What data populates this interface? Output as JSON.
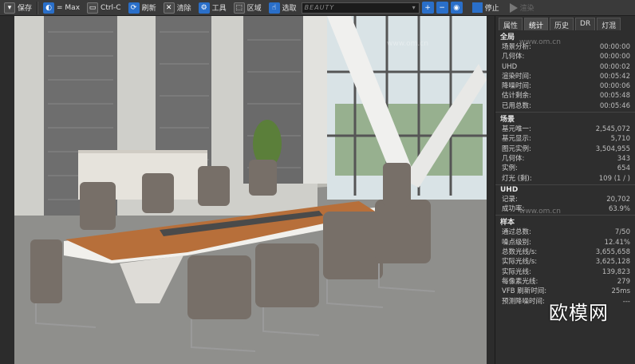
{
  "toolbar": {
    "save": "保存",
    "max": "= Max",
    "ctrl_c": "Ctrl-C",
    "refresh": "刷新",
    "clear": "清除",
    "tools": "工具",
    "region": "区域",
    "pick": "选取",
    "channel": "BEAUTY",
    "stop": "停止",
    "render": "渲染"
  },
  "tabs": [
    "属性",
    "统计",
    "历史",
    "DR",
    "灯混"
  ],
  "active_tab": 1,
  "sections": {
    "global": {
      "title": "全局",
      "rows": [
        {
          "k": "场景分析:",
          "v": "00:00:00"
        },
        {
          "k": "几何体:",
          "v": "00:00:00"
        },
        {
          "k": "UHD",
          "v": "00:00:02"
        },
        {
          "k": "渲染时间:",
          "v": "00:05:42"
        },
        {
          "k": "降噪时间:",
          "v": "00:00:06"
        },
        {
          "k": "估计剩余:",
          "v": "00:05:48"
        },
        {
          "k": "已用总数:",
          "v": "00:05:46"
        }
      ]
    },
    "scene": {
      "title": "场景",
      "rows": [
        {
          "k": "基元唯一:",
          "v": "2,545,072"
        },
        {
          "k": "基元显示:",
          "v": "5,710"
        },
        {
          "k": "图元实例:",
          "v": "3,504,955"
        },
        {
          "k": "几何体:",
          "v": "343"
        },
        {
          "k": "实例:",
          "v": "654"
        },
        {
          "k": "灯光 (剩):",
          "v": "109 (1 / )"
        }
      ]
    },
    "uhd": {
      "title": "UHD",
      "rows": [
        {
          "k": "记录:",
          "v": "20,702"
        },
        {
          "k": "成功率:",
          "v": "63.9%"
        }
      ]
    },
    "sampling": {
      "title": "样本",
      "rows": [
        {
          "k": "通过总数:",
          "v": "7/50"
        },
        {
          "k": "噪点级别:",
          "v": "12.41%"
        },
        {
          "k": "总数光线/s:",
          "v": "3,655,658"
        },
        {
          "k": "实际光线/s:",
          "v": "3,625,128"
        },
        {
          "k": "实际光线:",
          "v": "139,823"
        },
        {
          "k": "每像素光线:",
          "v": "279"
        },
        {
          "k": "VFB 刷新时间:",
          "v": "25ms"
        },
        {
          "k": "预测降噪时间:",
          "v": "---"
        }
      ]
    }
  },
  "watermarks": {
    "site": "www.om.cn",
    "brand": "欧模网"
  },
  "colors": {
    "accent": "#2a6fc9",
    "toolbar_bg": "#3a3a3a",
    "panel_bg": "#2e2e2e"
  }
}
